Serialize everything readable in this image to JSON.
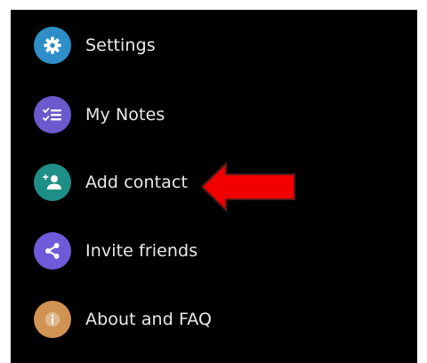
{
  "menu": {
    "items": [
      {
        "id": "settings",
        "label": "Settings",
        "icon": "gear-icon",
        "color": "#2e8fc8"
      },
      {
        "id": "my-notes",
        "label": "My Notes",
        "icon": "checklist-icon",
        "color": "#6a5acd"
      },
      {
        "id": "add-contact",
        "label": "Add contact",
        "icon": "add-person-icon",
        "color": "#1e8f86"
      },
      {
        "id": "invite-friends",
        "label": "Invite friends",
        "icon": "share-icon",
        "color": "#6f5bd9"
      },
      {
        "id": "about-faq",
        "label": "About and FAQ",
        "icon": "info-icon",
        "color": "#d09352"
      }
    ]
  },
  "annotation": {
    "icon": "left-arrow-icon",
    "color": "#f20000"
  }
}
